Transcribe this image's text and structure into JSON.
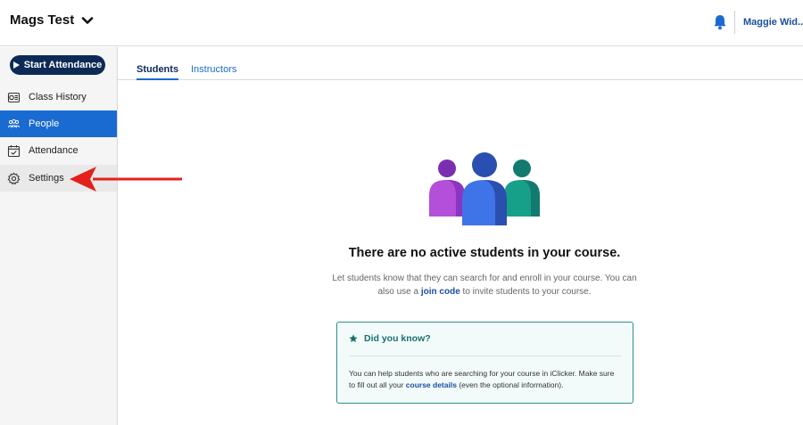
{
  "header": {
    "course_title": "Mags Test",
    "user_name": "Maggie Wid..."
  },
  "sidebar": {
    "start_attendance_label": "Start Attendance",
    "items": [
      {
        "label": "Class History",
        "icon": "class-history-icon"
      },
      {
        "label": "People",
        "icon": "people-icon",
        "active": true
      },
      {
        "label": "Attendance",
        "icon": "calendar-check-icon"
      },
      {
        "label": "Settings",
        "icon": "gear-icon"
      }
    ]
  },
  "tabs": [
    {
      "label": "Students",
      "active": true
    },
    {
      "label": "Instructors",
      "active": false
    }
  ],
  "empty_state": {
    "title": "There are no active students in your course.",
    "desc_before": "Let students know that they can search for and enroll in your course. You can also use a ",
    "join_code_link": "join code",
    "desc_after": " to invite students to your course."
  },
  "tip": {
    "heading": "Did you know?",
    "body_before": "You can help students who are searching for your course in iClicker. Make sure to fill out all your ",
    "course_details_link": "course details",
    "body_after": " (even the optional information)."
  },
  "colors": {
    "navy": "#0d2a57",
    "accent_blue": "#1a6bd1",
    "teal": "#17706b",
    "annotation_red": "#e3201b"
  }
}
